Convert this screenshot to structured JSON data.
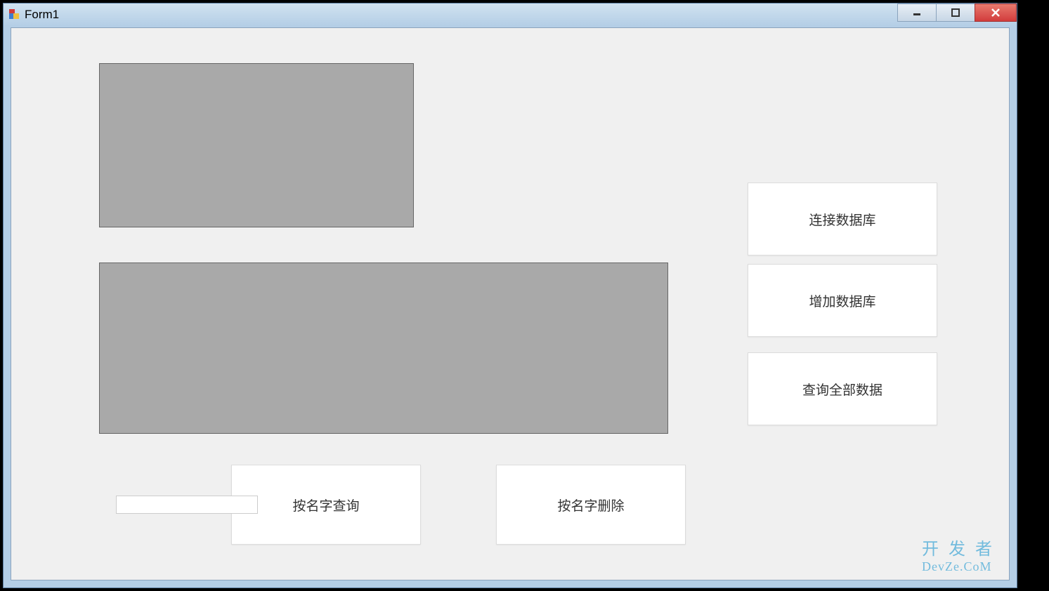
{
  "window": {
    "title": "Form1"
  },
  "buttons": {
    "connect_db": "连接数据库",
    "add_db": "增加数据库",
    "query_all": "查询全部数据",
    "query_by_name": "按名字查询",
    "delete_by_name": "按名字删除"
  },
  "input": {
    "name_value": ""
  },
  "watermark": {
    "line1": "开 发 者",
    "line2": "DevZe.CoM"
  }
}
